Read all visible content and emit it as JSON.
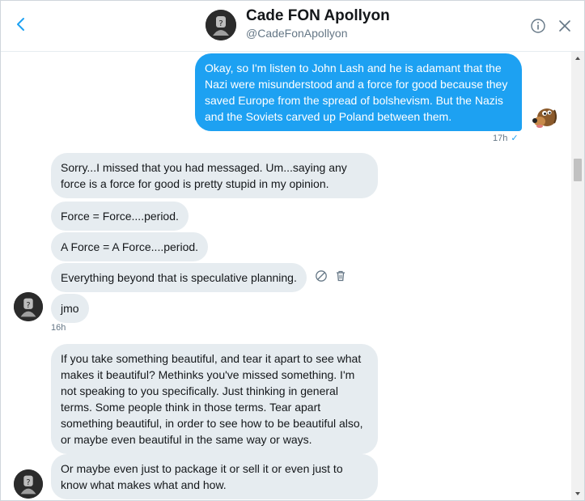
{
  "header": {
    "name": "Cade FON Apollyon",
    "handle": "@CadeFonApollyon"
  },
  "outgoing": {
    "text": "Okay, so I'm listen to John Lash and he is adamant that the Nazi were misunderstood and a force for good because they saved Europe from the spread of bolshevism. But the Nazis and the Soviets carved up Poland between them.",
    "time": "17h",
    "status": "✓"
  },
  "incoming_group_1": {
    "messages": [
      "Sorry...I missed that you had messaged. Um...saying any force is a force for good is pretty stupid in my opinion.",
      "Force = Force....period.",
      "A Force = A Force....period.",
      "Everything beyond that is speculative planning.",
      "jmo"
    ],
    "time": "16h"
  },
  "incoming_group_2": {
    "messages": [
      "If you take something beautiful, and tear it apart to see what makes it beautiful? Methinks you've missed something. I'm not speaking to you specifically. Just thinking in general terms. Some people think in those terms. Tear apart something beautiful, in order to see how to be beautiful also, or maybe even beautiful in the same way or ways.",
      "Or maybe even just to package it or sell it or even just to know what makes what and how."
    ]
  },
  "colors": {
    "accent": "#1da1f2",
    "incoming_bubble": "#e6ecf0",
    "muted_text": "#657786"
  },
  "icons": {
    "back": "chevron-left-icon",
    "info": "info-icon",
    "close": "close-icon",
    "hide": "block-icon",
    "delete": "trash-icon"
  }
}
